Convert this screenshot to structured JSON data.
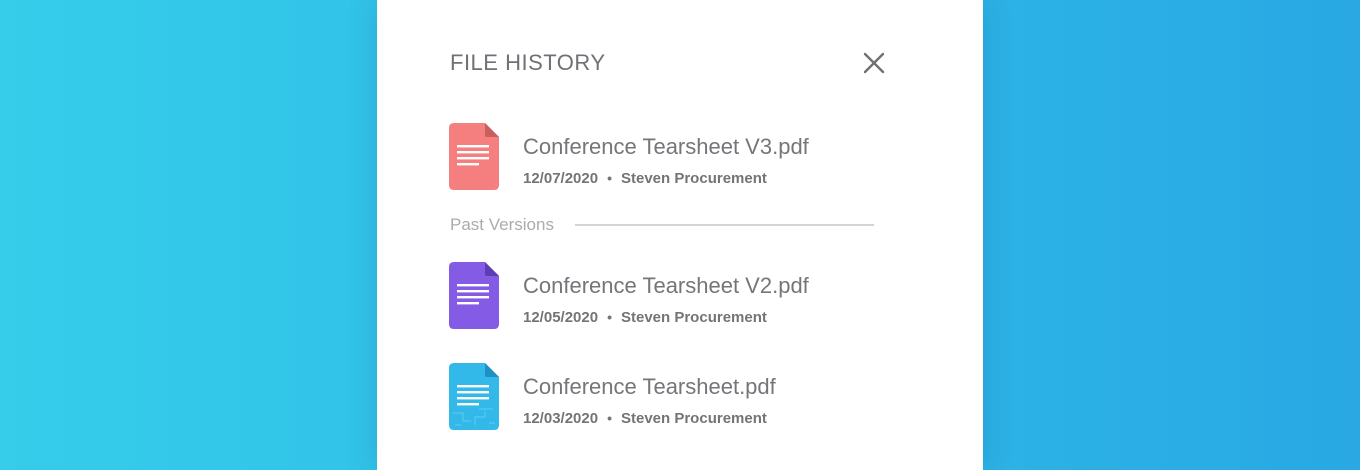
{
  "panel": {
    "title": "FILE HISTORY",
    "close_icon": "close-icon"
  },
  "current_file": {
    "name": "Conference Tearsheet V3.pdf",
    "date": "12/07/2020",
    "separator": "•",
    "author": "Steven Procurement",
    "icon": "document-icon",
    "icon_color": "#f57f7f"
  },
  "past_versions": {
    "label": "Past Versions",
    "items": [
      {
        "name": "Conference Tearsheet V2.pdf",
        "date": "12/05/2020",
        "separator": "•",
        "author": "Steven Procurement",
        "icon": "document-icon",
        "icon_color": "#845be5"
      },
      {
        "name": "Conference Tearsheet.pdf",
        "date": "12/03/2020",
        "separator": "•",
        "author": "Steven Procurement",
        "icon": "document-icon",
        "icon_color": "#33b8ea"
      }
    ]
  }
}
